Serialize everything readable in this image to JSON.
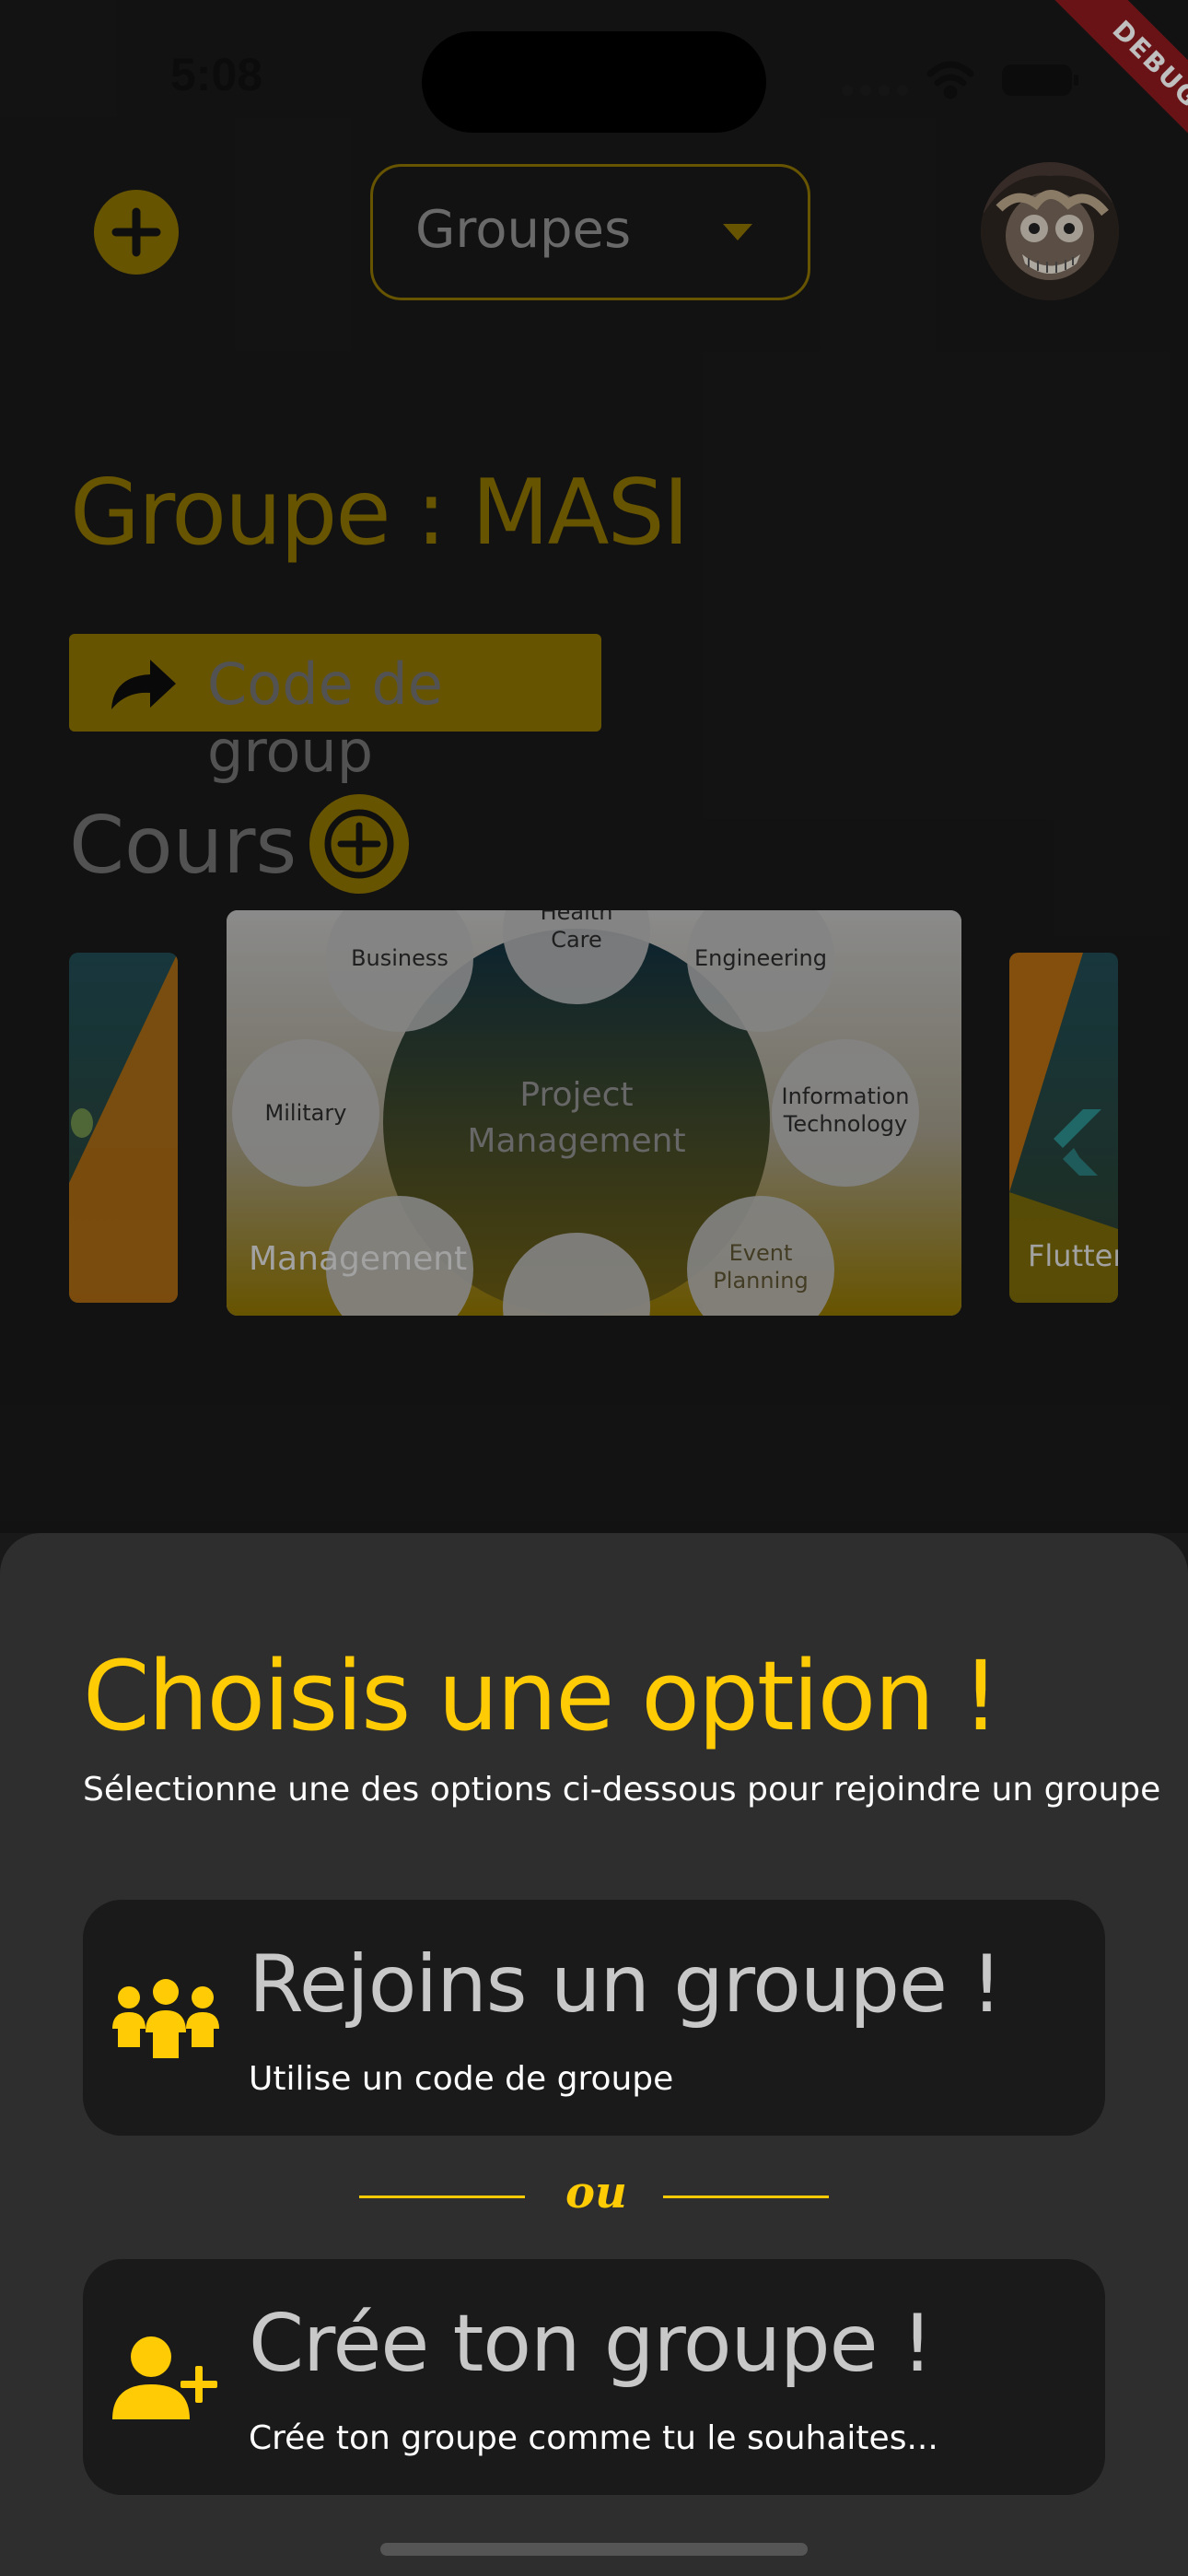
{
  "status_bar": {
    "time": "5:08",
    "debug_banner": "DEBUG"
  },
  "header": {
    "dropdown_label": "Groupes"
  },
  "group": {
    "title": "Groupe : MASI",
    "code_button_label": "Code de group",
    "courses_label": "Cours"
  },
  "courses": [
    {
      "name": "",
      "position": "left-partial"
    },
    {
      "name": "Management",
      "position": "center",
      "image_labels": [
        "Health Care",
        "Business",
        "Engineering",
        "Military",
        "Project Management",
        "Information Technology",
        "Event Planning"
      ]
    },
    {
      "name": "Flutter",
      "position": "right-partial"
    }
  ],
  "sheet": {
    "title": "Choisis une option !",
    "subtitle": "Sélectionne une des options ci-dessous pour rejoindre un groupe",
    "join": {
      "title": "Rejoins un groupe !",
      "description": "Utilise un code de groupe",
      "icon": "group-icon"
    },
    "divider_label": "ou",
    "create": {
      "title": "Crée ton groupe !",
      "description": "Crée ton groupe comme tu le souhaites...",
      "icon": "person-add-icon"
    }
  },
  "colors": {
    "accent": "#ffcb05",
    "accent_dim": "#8a7000",
    "background": "#191919",
    "sheet": "#2e2e2e",
    "card": "#1a1a1a"
  }
}
